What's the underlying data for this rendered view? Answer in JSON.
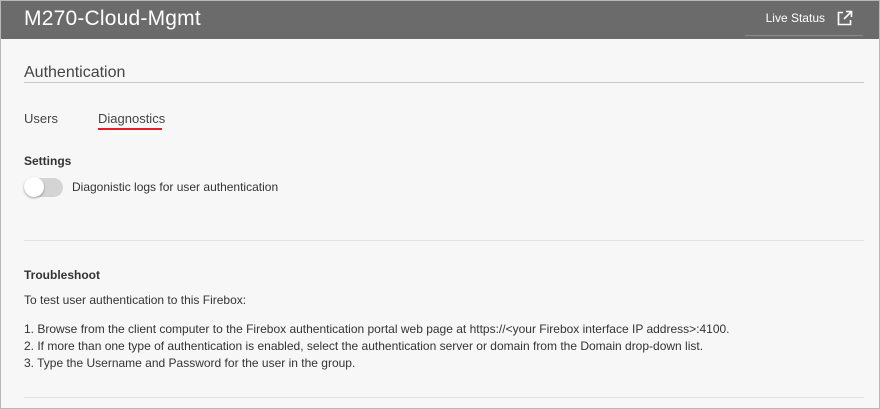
{
  "header": {
    "device_name": "M270-Cloud-Mgmt",
    "live_status_label": "Live Status",
    "live_status_icon": "external-link-icon"
  },
  "page": {
    "section_title": "Authentication"
  },
  "tabs": [
    {
      "label": "Users",
      "active": false
    },
    {
      "label": "Diagnostics",
      "active": true
    }
  ],
  "settings": {
    "heading": "Settings",
    "toggle_label": "Diagonistic logs for user authentication",
    "toggle_enabled": false
  },
  "troubleshoot": {
    "heading": "Troubleshoot",
    "intro": "To test user authentication to this Firebox:",
    "steps": [
      "1. Browse from the client computer to the Firebox authentication portal web page at https://<your Firebox interface IP address>:4100.",
      "2. If more than one type of authentication is enabled, select the authentication server or domain from the Domain drop-down list.",
      "3. Type the Username and Password for the user in the group."
    ]
  },
  "colors": {
    "header_bg": "#6b6b6b",
    "page_bg": "#f7f7f7",
    "active_tab_underline": "#e41e26",
    "toggle_off": "#d4d4d4"
  }
}
